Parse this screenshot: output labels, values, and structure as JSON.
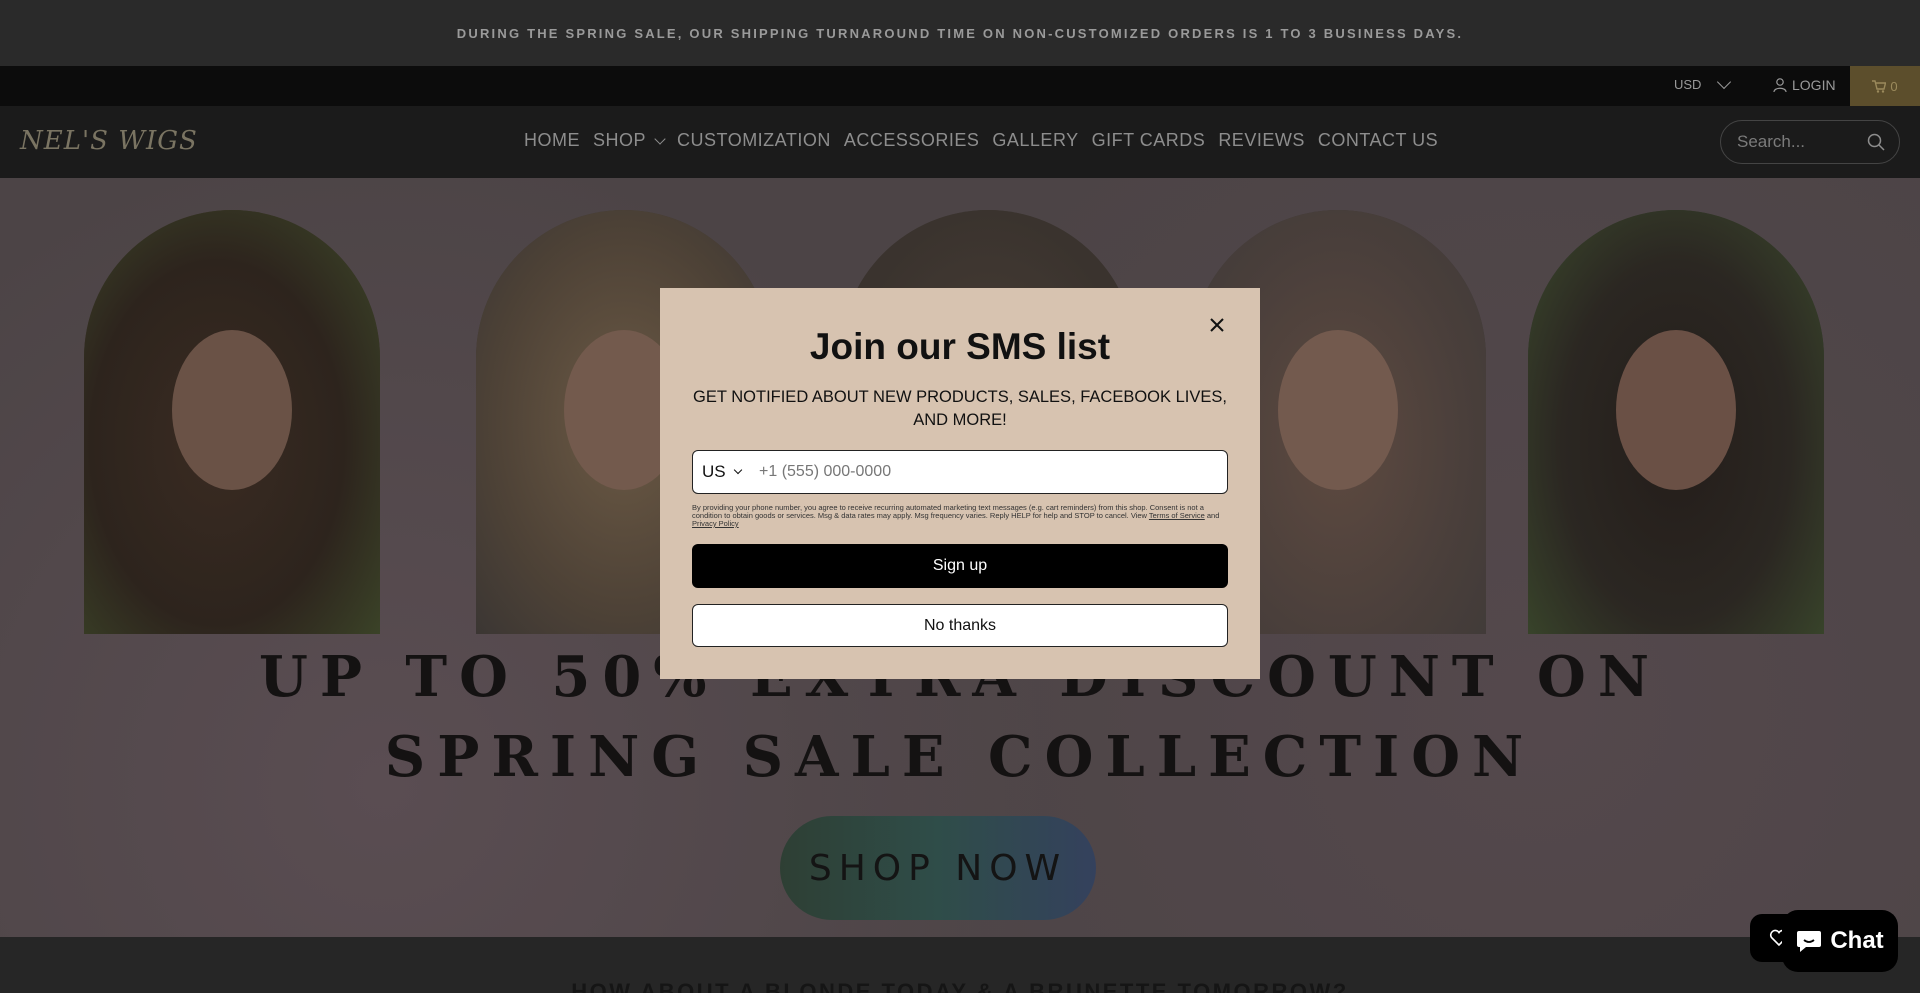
{
  "announcement": "DURING THE SPRING SALE, OUR SHIPPING TURNAROUND TIME ON NON-CUSTOMIZED ORDERS IS 1 TO 3 BUSINESS DAYS.",
  "utility": {
    "currency": "USD",
    "login_label": "LOGIN",
    "cart_count": "0"
  },
  "header": {
    "logo_text": "NEL'S WIGS",
    "nav": [
      {
        "label": "HOME"
      },
      {
        "label": "SHOP"
      },
      {
        "label": "CUSTOMIZATION"
      },
      {
        "label": "ACCESSORIES"
      },
      {
        "label": "GALLERY"
      },
      {
        "label": "GIFT CARDS"
      },
      {
        "label": "REVIEWS"
      },
      {
        "label": "CONTACT US"
      }
    ],
    "search_placeholder": "Search..."
  },
  "hero": {
    "headline_line1": "UP TO 50% EXTRA DISCOUNT ON",
    "headline_line2": "SPRING SALE COLLECTION",
    "cta_label": "SHOP NOW"
  },
  "below": {
    "tagline": "HOW ABOUT A BLONDE TODAY & A BRUNETTE TOMORROW?"
  },
  "chat": {
    "label": "Chat"
  },
  "modal": {
    "title": "Join our SMS list",
    "subtitle": "GET NOTIFIED ABOUT NEW PRODUCTS, SALES, FACEBOOK LIVES, AND MORE!",
    "country": "US",
    "phone_placeholder": "+1 (555) 000-0000",
    "legal_text": "By providing your phone number, you agree to receive recurring automated marketing text messages (e.g. cart reminders) from this shop. Consent is not a condition to obtain goods or services. Msg & data rates may apply. Msg frequency varies. Reply HELP for help and STOP to cancel. View",
    "terms_link": "Terms of Service",
    "and_text": "and",
    "privacy_link": "Privacy Policy",
    "signup_label": "Sign up",
    "nothanks_label": "No thanks"
  },
  "colors": {
    "modal_bg": "#d7c3b0",
    "cart_bg": "#5c4e2c",
    "hero_bg": "#4c4446"
  }
}
